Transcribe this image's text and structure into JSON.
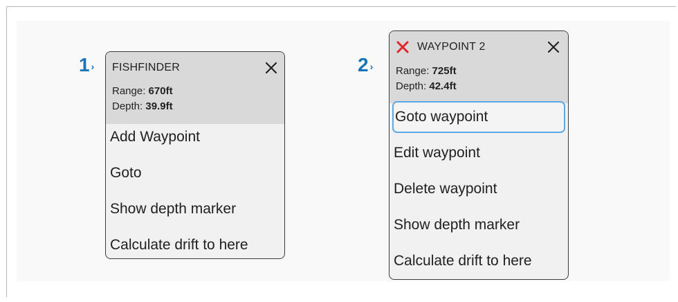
{
  "steps": {
    "first": "1",
    "second": "2",
    "chevron": "›"
  },
  "fishfinder_menu": {
    "title": "FISHFINDER",
    "range_label": "Range:",
    "range_value": "670ft",
    "depth_label": "Depth:",
    "depth_value": "39.9ft",
    "items": [
      "Add Waypoint",
      "Goto",
      "Show depth marker",
      "Calculate drift to here"
    ],
    "close_icon": "close-icon"
  },
  "waypoint_menu": {
    "title": "WAYPOINT 2",
    "range_label": "Range:",
    "range_value": "725ft",
    "depth_label": "Depth:",
    "depth_value": "42.4ft",
    "items": [
      "Goto waypoint",
      "Edit waypoint",
      "Delete waypoint",
      "Show depth marker",
      "Calculate drift to here"
    ],
    "focused_item": "Goto waypoint",
    "close_icon": "close-icon",
    "waypoint_icon": "red-x-waypoint-icon"
  },
  "colors": {
    "step_number": "#1a74b8",
    "header_bg": "#d9d9d9",
    "menu_bg": "#f1f1f1",
    "focus_outline": "#5aa9e6",
    "waypoint_marker": "#e0262b"
  }
}
